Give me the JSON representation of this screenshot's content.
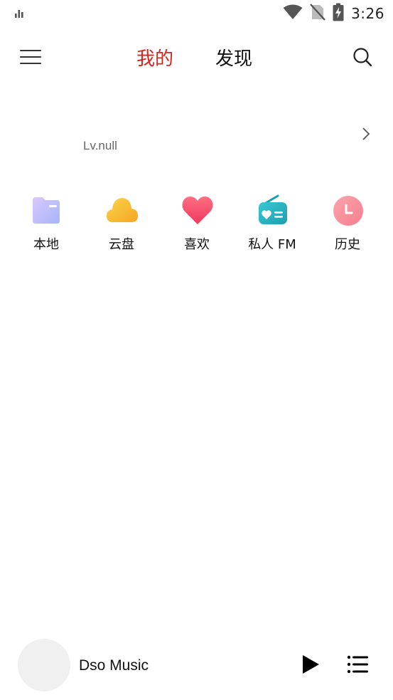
{
  "status_bar": {
    "time": "3:26",
    "icons": [
      "signal-bars-icon",
      "wifi-icon",
      "no-sim-icon",
      "battery-charging-icon"
    ]
  },
  "top_nav": {
    "menu_icon": "hamburger-menu-icon",
    "tabs": [
      {
        "label": "我的",
        "active": true
      },
      {
        "label": "发现",
        "active": false
      }
    ],
    "search_icon": "search-icon",
    "colors": {
      "active": "#d8251f",
      "inactive": "#111111"
    }
  },
  "profile": {
    "level": "Lv.null",
    "arrow_icon": "chevron-right-icon"
  },
  "quick_access": [
    {
      "label": "本地",
      "icon": "folder-icon",
      "color": "#b8a8f8"
    },
    {
      "label": "云盘",
      "icon": "cloud-icon",
      "color": "#f7b733"
    },
    {
      "label": "喜欢",
      "icon": "heart-icon",
      "color": "#f5506e"
    },
    {
      "label": "私人 FM",
      "icon": "radio-icon",
      "color": "#2cb5c0"
    },
    {
      "label": "历史",
      "icon": "clock-icon",
      "color": "#f78f9a"
    }
  ],
  "mini_player": {
    "title": "Dso Music",
    "play_icon": "play-icon",
    "playlist_icon": "playlist-icon"
  }
}
